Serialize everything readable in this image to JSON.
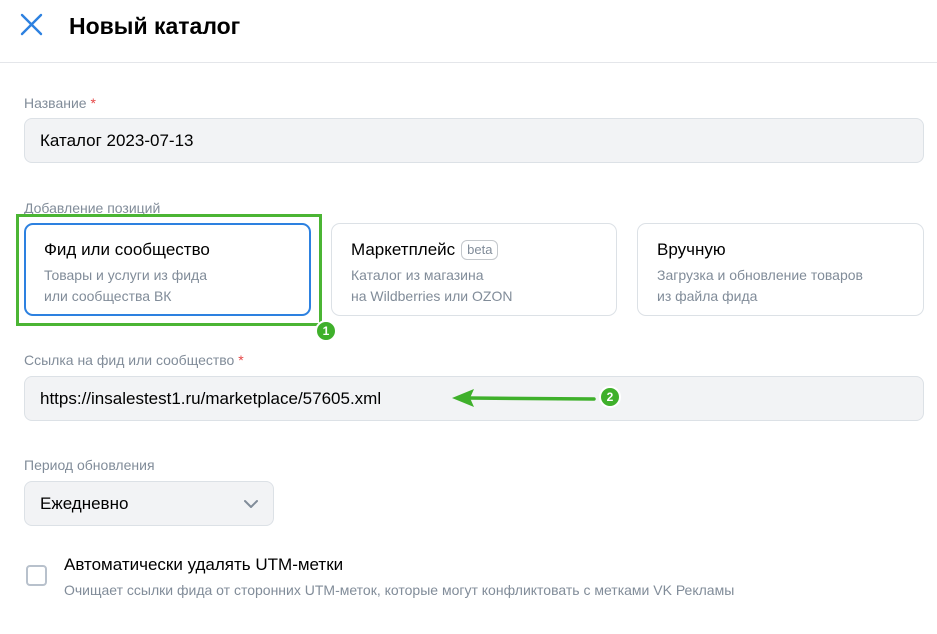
{
  "header": {
    "title": "Новый каталог",
    "close_icon": "close-icon"
  },
  "name_field": {
    "label": "Название",
    "required_mark": "*",
    "value": "Каталог 2023-07-13"
  },
  "positions": {
    "label": "Добавление позиций",
    "options": [
      {
        "title": "Фид или сообщество",
        "desc_line1": "Товары и услуги из фида",
        "desc_line2": "или сообщества ВК",
        "selected": true
      },
      {
        "title": "Маркетплейс",
        "badge": "beta",
        "desc_line1": "Каталог из магазина",
        "desc_line2": "на Wildberries или OZON",
        "selected": false
      },
      {
        "title": "Вручную",
        "desc_line1": "Загрузка и обновление товаров",
        "desc_line2": "из файла фида",
        "selected": false
      }
    ]
  },
  "feed_field": {
    "label": "Ссылка на фид или сообщество",
    "required_mark": "*",
    "value": "https://insalestest1.ru/marketplace/57605.xml"
  },
  "update_period": {
    "label": "Период обновления",
    "value": "Ежедневно",
    "icon": "chevron-down-icon"
  },
  "utm_option": {
    "title": "Автоматически удалять UTM-метки",
    "description": "Очищает ссылки фида от сторонних UTM-меток, которые могут конфликтовать с метками VK Рекламы",
    "checked": false
  },
  "annotations": {
    "badge_1": "1",
    "badge_2": "2",
    "color": "#3fb02b"
  },
  "colors": {
    "accent": "#2d81e0",
    "highlight": "#4bb534",
    "required": "#e64646",
    "secondary_text": "#818c99"
  }
}
